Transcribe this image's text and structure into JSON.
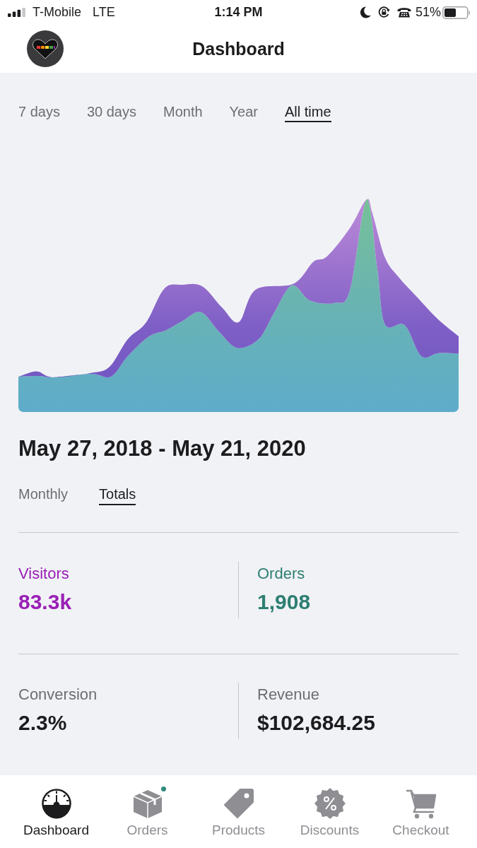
{
  "status_bar": {
    "carrier": "T-Mobile",
    "network": "LTE",
    "time": "1:14 PM",
    "battery": "51%"
  },
  "header": {
    "title": "Dashboard"
  },
  "range_tabs": [
    {
      "label": "7 days",
      "selected": false
    },
    {
      "label": "30 days",
      "selected": false
    },
    {
      "label": "Month",
      "selected": false
    },
    {
      "label": "Year",
      "selected": false
    },
    {
      "label": "All time",
      "selected": true
    }
  ],
  "period": {
    "title": "May 27, 2018 - May 21, 2020"
  },
  "view_tabs": [
    {
      "label": "Monthly",
      "selected": false
    },
    {
      "label": "Totals",
      "selected": true
    }
  ],
  "stats": [
    {
      "label": "Visitors",
      "value": "83.3k",
      "color": "#9a1fb5"
    },
    {
      "label": "Orders",
      "value": "1,908",
      "color": "#2e7f72"
    },
    {
      "label": "Conversion",
      "value": "2.3%"
    },
    {
      "label": "Revenue",
      "value": "$102,684.25"
    }
  ],
  "nav": [
    {
      "label": "Dashboard",
      "kind": "dashboard",
      "selected": true,
      "badge": false
    },
    {
      "label": "Orders",
      "kind": "orders",
      "selected": false,
      "badge": true
    },
    {
      "label": "Products",
      "kind": "products",
      "selected": false,
      "badge": false
    },
    {
      "label": "Discounts",
      "kind": "discounts",
      "selected": false,
      "badge": false
    },
    {
      "label": "Checkout",
      "kind": "checkout",
      "selected": false,
      "badge": false
    }
  ]
}
